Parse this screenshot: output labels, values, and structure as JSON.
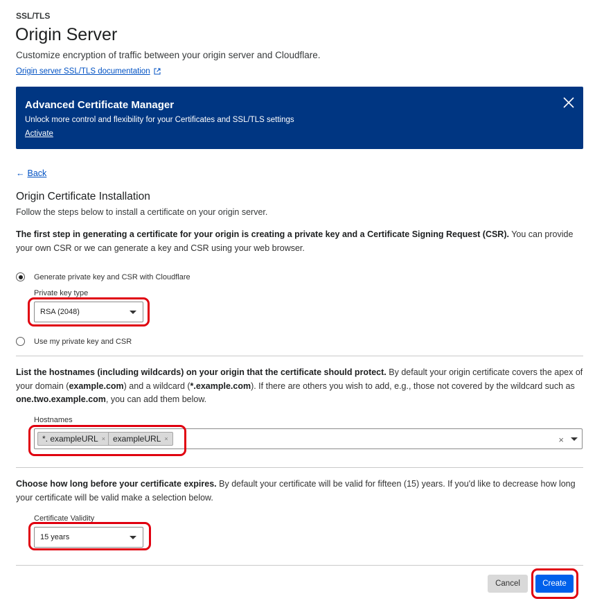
{
  "header": {
    "eyebrow": "SSL/TLS",
    "title": "Origin Server",
    "subtitle": "Customize encryption of traffic between your origin server and Cloudflare.",
    "doc_link": "Origin server SSL/TLS documentation"
  },
  "banner": {
    "title": "Advanced Certificate Manager",
    "text": "Unlock more control and flexibility for your Certificates and SSL/TLS settings",
    "link": "Activate",
    "background": "#003682"
  },
  "back": {
    "arrow": "←",
    "label": "Back"
  },
  "installation": {
    "title": "Origin Certificate Installation",
    "description": "Follow the steps below to install a certificate on your origin server."
  },
  "step1": {
    "bold": "The first step in generating a certificate for your origin is creating a private key and a Certificate Signing Request (CSR).",
    "rest": " You can provide your own CSR or we can generate a key and CSR using your web browser.",
    "option_generate": "Generate private key and CSR with Cloudflare",
    "key_type_label": "Private key type",
    "key_type_value": "RSA (2048)",
    "option_own": "Use my private key and CSR"
  },
  "step2": {
    "bold": "List the hostnames (including wildcards) on your origin that the certificate should protect.",
    "part1": " By default your origin certificate covers the apex of your domain (",
    "apex": "example.com",
    "part2": ") and a wildcard (",
    "wildcard": "*.example.com",
    "part3": "). If there are others you wish to add, e.g., those not covered by the wildcard such as ",
    "example_sub": "one.two.example.com",
    "part4": ", you can add them below.",
    "hostnames_label": "Hostnames",
    "tags": [
      "*. exampleURL",
      "exampleURL"
    ],
    "tag_remove": "×",
    "clear": "×"
  },
  "step3": {
    "bold": "Choose how long before your certificate expires.",
    "rest": " By default your certificate will be valid for fifteen (15) years. If you'd like to decrease how long your certificate will be valid make a selection below.",
    "validity_label": "Certificate Validity",
    "validity_value": "15 years"
  },
  "actions": {
    "cancel": "Cancel",
    "create": "Create",
    "primary_color": "#0060eb"
  },
  "annotation_color": "#e0000f"
}
